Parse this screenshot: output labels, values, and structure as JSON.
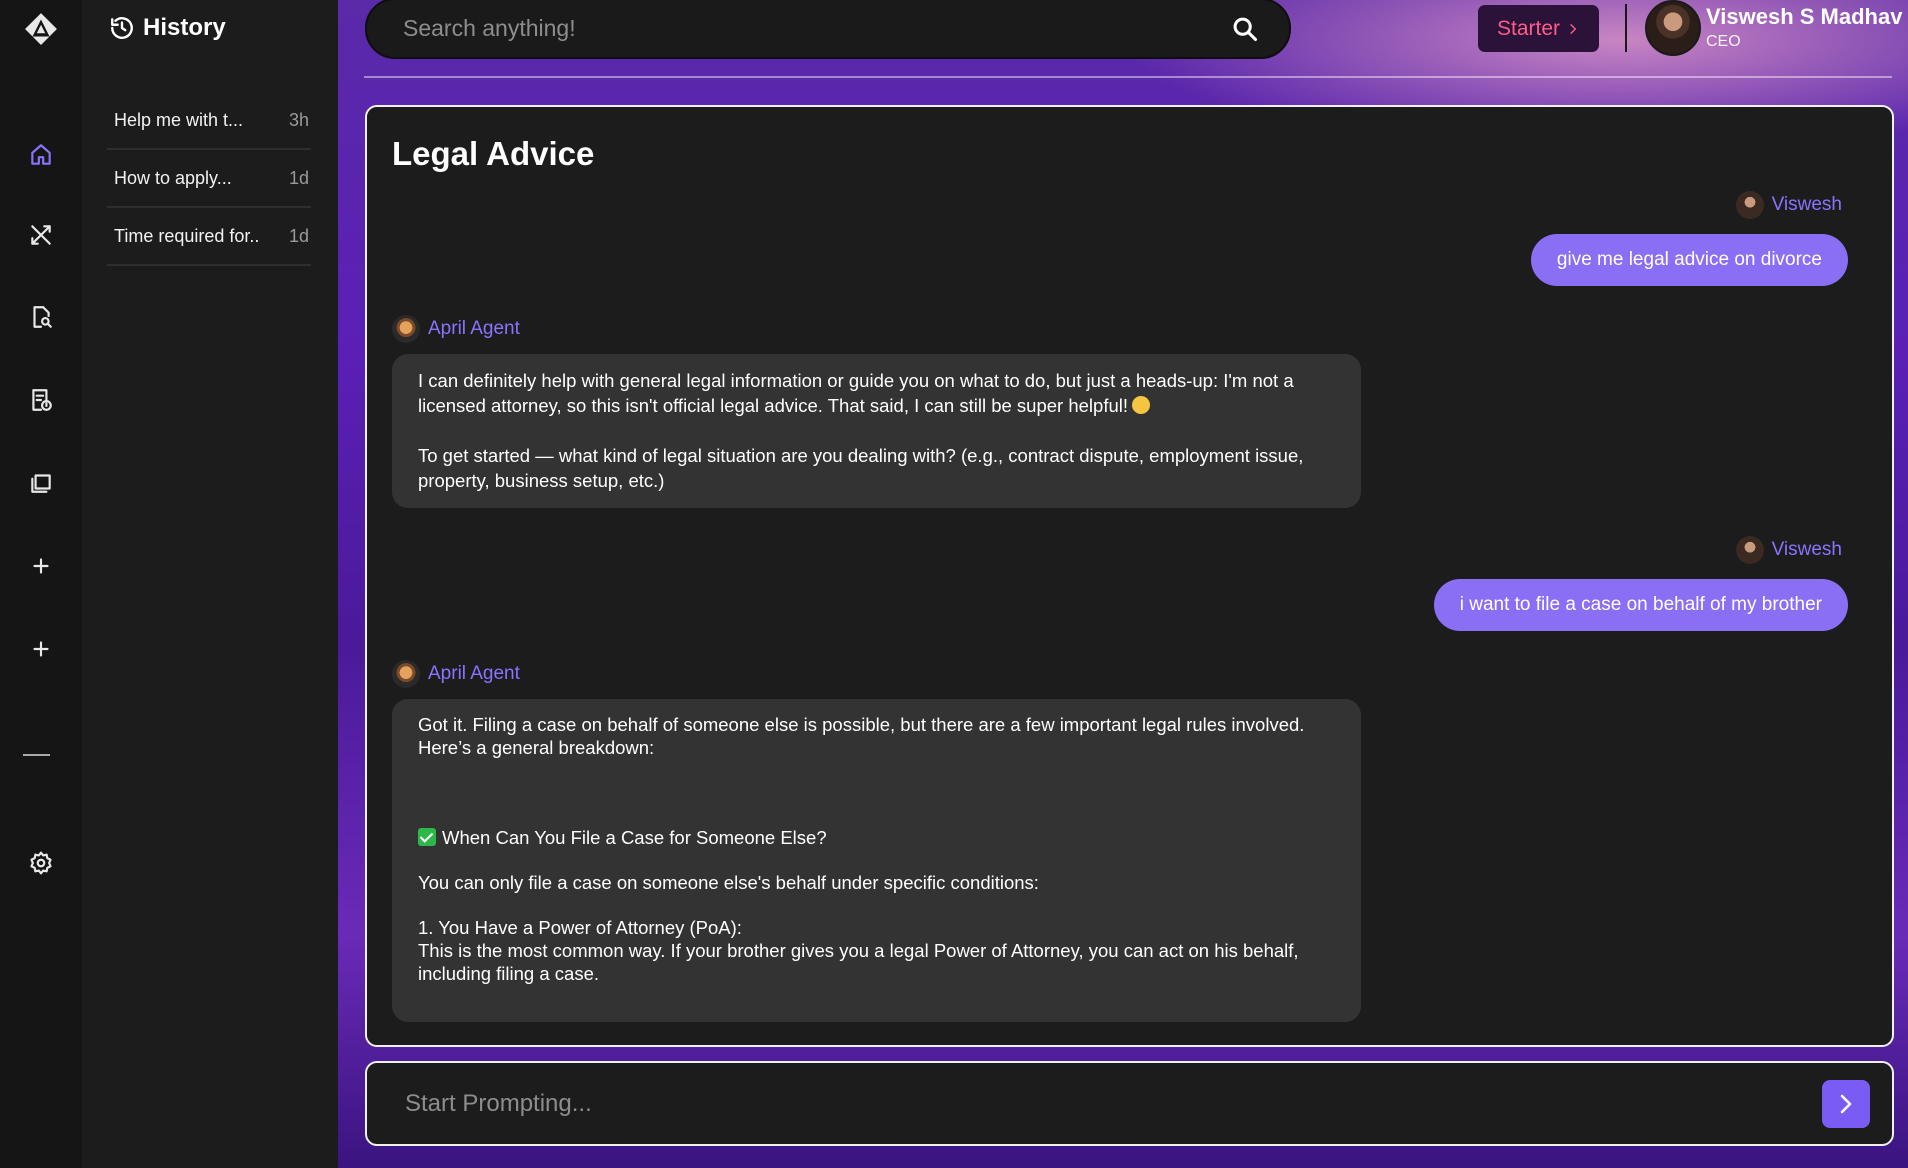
{
  "rail": {
    "icons": [
      "logo-icon",
      "home-icon",
      "tools-icon",
      "document-search-icon",
      "report-icon",
      "folder-icon",
      "plus-icon",
      "plus-icon",
      "settings-icon"
    ],
    "active": "home-icon",
    "accent": "#8a73ff"
  },
  "history": {
    "title": "History",
    "items": [
      {
        "label": "Help me with t...",
        "time": "3h"
      },
      {
        "label": "How to apply...",
        "time": "1d"
      },
      {
        "label": "Time required for..",
        "time": "1d"
      }
    ]
  },
  "topbar": {
    "search_placeholder": "Search anything!",
    "plan_label": "Starter",
    "user_name": "Viswesh S Madhav",
    "user_role": "CEO"
  },
  "chat": {
    "title": "Legal Advice",
    "messages": [
      {
        "author": "Viswesh",
        "text": "give me legal advice on divorce"
      },
      {
        "author": "April Agent",
        "lines": [
          "I can definitely help with general legal information or guide you on what to do, but just a heads-up: I'm not a licensed attorney, so this isn't official legal advice. That said, I can still be super helpful!",
          "To get started — what kind of legal situation are you dealing with? (e.g., contract dispute, employment issue, property, business setup, etc.)"
        ]
      },
      {
        "author": "Viswesh",
        "text": "i want to file a case on behalf of my brother"
      },
      {
        "author": "April Agent",
        "lines": [
          "Got it. Filing a case on behalf of someone else is possible, but there are a few important legal rules involved.",
          "Here’s a general breakdown:",
          "When Can You File a Case for Someone Else?",
          "You can only file a case on someone else's behalf under specific conditions:",
          "1. You Have a Power of Attorney (PoA):",
          "This is the most common way. If your brother gives you a legal Power of Attorney, you can act on his behalf, including filing a case."
        ]
      }
    ]
  },
  "prompt": {
    "placeholder": "Start Prompting..."
  },
  "colors": {
    "accent": "#8a6ff5",
    "starter_text": "#ff5c8a",
    "panel": "#1c1c1c",
    "bubble": "#333333"
  }
}
